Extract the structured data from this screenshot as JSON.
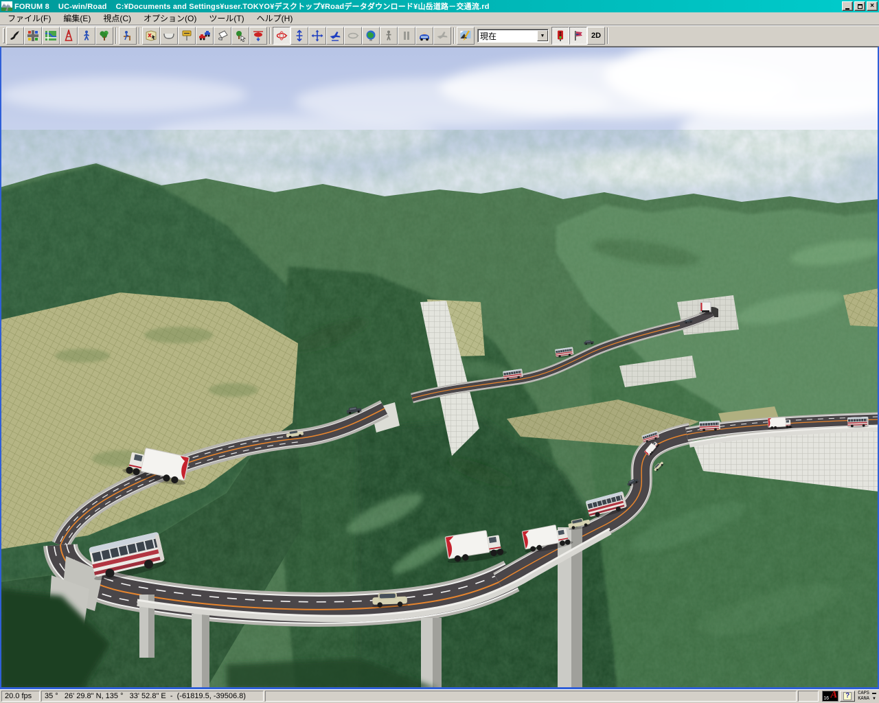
{
  "window": {
    "title": "FORUM 8    UC-win/Road    C:¥Documents and Settings¥user.TOKYO¥デスクトップ¥Roadデータダウンロード¥山岳道路－交通流.rd",
    "controls": {
      "minimize": "minimize",
      "restore": "restore",
      "close": "close"
    }
  },
  "menu": {
    "items": [
      {
        "label": "ファイル(F)"
      },
      {
        "label": "編集(E)"
      },
      {
        "label": "視点(C)"
      },
      {
        "label": "オプション(O)"
      },
      {
        "label": "ツール(T)"
      },
      {
        "label": "ヘルプ(H)"
      }
    ]
  },
  "toolbar": {
    "buttons": [
      {
        "name": "japan-map",
        "state": "normal"
      },
      {
        "name": "road-plan",
        "state": "normal"
      },
      {
        "name": "city-map",
        "state": "normal"
      },
      {
        "name": "tower",
        "state": "normal"
      },
      {
        "name": "pedestrian",
        "state": "normal"
      },
      {
        "name": "tree",
        "state": "normal"
      },
      {
        "name": "drive-simulation",
        "state": "normal"
      },
      {
        "name": "map-marker",
        "state": "normal"
      },
      {
        "name": "road-section",
        "state": "normal"
      },
      {
        "name": "signpost",
        "state": "normal"
      },
      {
        "name": "traffic-cars",
        "state": "normal"
      },
      {
        "name": "texture-paint",
        "state": "normal"
      },
      {
        "name": "tree-place",
        "state": "normal"
      },
      {
        "name": "helicopter-view",
        "state": "normal"
      },
      {
        "name": "rotate-view",
        "state": "active"
      },
      {
        "name": "pan-vertical",
        "state": "normal"
      },
      {
        "name": "pan-view",
        "state": "normal"
      },
      {
        "name": "fly-view",
        "state": "normal"
      },
      {
        "name": "orbit-view",
        "state": "disabled"
      },
      {
        "name": "world-view",
        "state": "normal"
      },
      {
        "name": "walk-view",
        "state": "normal"
      },
      {
        "name": "pause",
        "state": "disabled"
      },
      {
        "name": "drive-view",
        "state": "normal"
      },
      {
        "name": "flight-view",
        "state": "disabled"
      },
      {
        "name": "scenery-options",
        "state": "normal"
      },
      {
        "name": "traffic-signal",
        "state": "active"
      },
      {
        "name": "flag-marker",
        "state": "active"
      }
    ],
    "view_select": {
      "value": "現在"
    },
    "button_2d": "2D"
  },
  "viewport": {
    "scene_colors": {
      "sky": "#c7d2ec",
      "cloud": "#f6f8fc",
      "mountain_dark": "#2c5634",
      "mountain_light": "#5d8a60",
      "valley": "#1e4426",
      "field_khaki": "#b5b584",
      "road_asphalt": "#4a4649",
      "road_center_line": "#e8862e",
      "lane_line": "#ffffff",
      "retaining_wall": "#e3e4dd",
      "bridge_concrete": "#c9c9c4",
      "bus_stripe": "#b23642",
      "truck_mark": "#c5232e"
    }
  },
  "status_bar": {
    "fps": "20.0 fps",
    "coordinates": "35 °   26' 29.8\" N, 135 °   33' 52.8\" E  -  (-61819.5, -39506.8)",
    "ime_page": "16",
    "help": "?",
    "caps": "CAPS",
    "kana": "KANA"
  }
}
